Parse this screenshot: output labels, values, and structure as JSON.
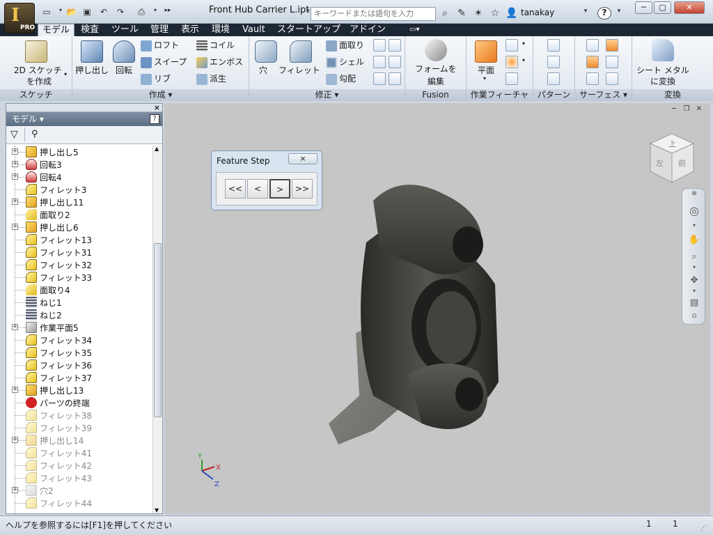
{
  "titlebar": {
    "app_glyph": "I",
    "app_badge": "PRO",
    "document_title": "Front Hub Carrier L.ipt",
    "search_placeholder": "キーワードまたは語句を入力",
    "user_name": "tanakay",
    "help_label": "?"
  },
  "tabs": [
    "モデル",
    "検査",
    "ツール",
    "管理",
    "表示",
    "環境",
    "Vault",
    "スタートアップ",
    "アドイン"
  ],
  "active_tab": "モデル",
  "ribbon": {
    "sketch": {
      "label": "スケッチ",
      "create_2d_line1": "2D スケッチ",
      "create_2d_line2": "を作成"
    },
    "create": {
      "label": "作成 ▾",
      "extrude": "押し出し",
      "revolve": "回転",
      "loft": "ロフト",
      "sweep": "スイープ",
      "rib": "リブ",
      "coil": "コイル",
      "emboss": "エンボス",
      "derive": "派生"
    },
    "modify": {
      "label": "修正 ▾",
      "hole": "穴",
      "fillet": "フィレット",
      "chamfer": "面取り",
      "shell": "シェル",
      "draft": "勾配"
    },
    "fusion": {
      "label": "Fusion",
      "edit_form_line1": "フォームを",
      "edit_form_line2": "編集"
    },
    "work_features": {
      "label": "作業フィーチャ",
      "plane": "平面"
    },
    "pattern": {
      "label": "パターン"
    },
    "surface": {
      "label": "サーフェス ▾"
    },
    "convert": {
      "label": "変換",
      "sheet_metal_line1": "シート メタル",
      "sheet_metal_line2": "に変換"
    }
  },
  "browser": {
    "title": "モデル ▾",
    "help_label": "?",
    "close_label": "×",
    "items": [
      {
        "label": "押し出し5",
        "type": "extrude",
        "expandable": true,
        "dim": false
      },
      {
        "label": "回転3",
        "type": "revolve",
        "expandable": true,
        "dim": false
      },
      {
        "label": "回転4",
        "type": "revolve",
        "expandable": true,
        "dim": false
      },
      {
        "label": "フィレット3",
        "type": "fillet",
        "expandable": false,
        "dim": false
      },
      {
        "label": "押し出し11",
        "type": "extrude",
        "expandable": true,
        "dim": false
      },
      {
        "label": "面取り2",
        "type": "chamfer",
        "expandable": false,
        "dim": false
      },
      {
        "label": "押し出し6",
        "type": "extrude",
        "expandable": true,
        "dim": false
      },
      {
        "label": "フィレット13",
        "type": "fillet",
        "expandable": false,
        "dim": false
      },
      {
        "label": "フィレット31",
        "type": "fillet",
        "expandable": false,
        "dim": false
      },
      {
        "label": "フィレット32",
        "type": "fillet",
        "expandable": false,
        "dim": false
      },
      {
        "label": "フィレット33",
        "type": "fillet",
        "expandable": false,
        "dim": false
      },
      {
        "label": "面取り4",
        "type": "chamfer",
        "expandable": false,
        "dim": false
      },
      {
        "label": "ねじ1",
        "type": "thread",
        "expandable": false,
        "dim": false
      },
      {
        "label": "ねじ2",
        "type": "thread",
        "expandable": false,
        "dim": false
      },
      {
        "label": "作業平面5",
        "type": "workplane",
        "expandable": true,
        "dim": false
      },
      {
        "label": "フィレット34",
        "type": "fillet",
        "expandable": false,
        "dim": false
      },
      {
        "label": "フィレット35",
        "type": "fillet",
        "expandable": false,
        "dim": false
      },
      {
        "label": "フィレット36",
        "type": "fillet",
        "expandable": false,
        "dim": false
      },
      {
        "label": "フィレット37",
        "type": "fillet",
        "expandable": false,
        "dim": false
      },
      {
        "label": "押し出し13",
        "type": "extrude",
        "expandable": true,
        "dim": false
      },
      {
        "label": "パーツの終端",
        "type": "end",
        "expandable": false,
        "dim": false
      },
      {
        "label": "フィレット38",
        "type": "fillet",
        "expandable": false,
        "dim": true
      },
      {
        "label": "フィレット39",
        "type": "fillet",
        "expandable": false,
        "dim": true
      },
      {
        "label": "押し出し14",
        "type": "extrude",
        "expandable": true,
        "dim": true
      },
      {
        "label": "フィレット41",
        "type": "fillet",
        "expandable": false,
        "dim": true
      },
      {
        "label": "フィレット42",
        "type": "fillet",
        "expandable": false,
        "dim": true
      },
      {
        "label": "フィレット43",
        "type": "fillet",
        "expandable": false,
        "dim": true
      },
      {
        "label": "穴2",
        "type": "hole",
        "expandable": true,
        "dim": true
      },
      {
        "label": "フィレット44",
        "type": "fillet",
        "expandable": false,
        "dim": true
      }
    ]
  },
  "feature_step": {
    "title": "Feature Step",
    "close_label": "×",
    "buttons": [
      "<<",
      "<",
      ">",
      ">>"
    ]
  },
  "viewcube": {
    "top_face": "上",
    "left_face": "左",
    "front_face": "前"
  },
  "axis": {
    "x": "X",
    "y": "Y",
    "z": "Z"
  },
  "statusbar": {
    "help_text": "ヘルプを参照するには[F1]を押してください",
    "count1": "1",
    "count2": "1"
  },
  "colors": {
    "accent": "#1d2733",
    "model": "#3a3a37",
    "viewport": "#c6c6c6"
  }
}
